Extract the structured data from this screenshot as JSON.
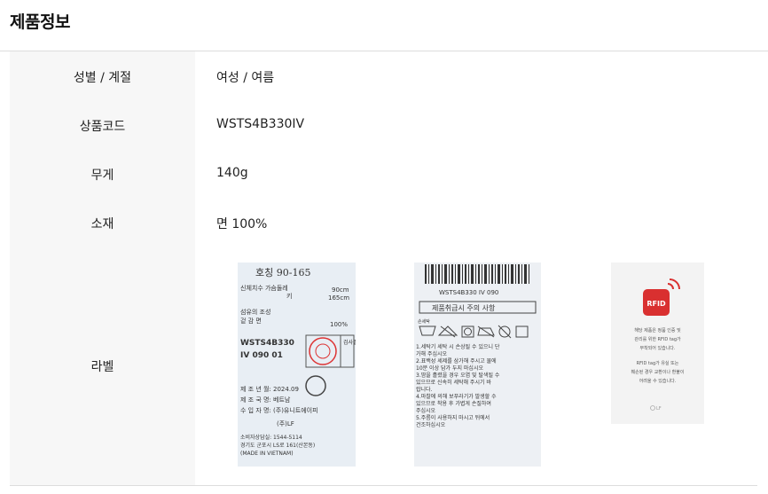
{
  "title": "제품정보",
  "rows": [
    {
      "label": "성별 / 계절",
      "value": "여성 / 여름"
    },
    {
      "label": "상품코드",
      "value": "WSTS4B330IV"
    },
    {
      "label": "무게",
      "value": "140g"
    },
    {
      "label": "소재",
      "value": "면 100%"
    },
    {
      "label": "라벨",
      "value": ""
    }
  ],
  "label1": {
    "lines": [
      "호칭  90-165",
      "신체치수 가슴둘레",
      "키",
      "90cm",
      "165cm",
      "섬유의 조성",
      "겉 감        면",
      "100%",
      "WSTS4B330",
      "IV 090 01",
      "검사필",
      "제 조 년 월: 2024.09",
      "제 조 국 명: 베트남",
      "수 입 자 명: (주)유니트에이피",
      "(주)LF",
      "소비자상담실: 1544-5114",
      "경기도 군포시 LS로 161(산본동)",
      "(MADE IN VIETNAM)"
    ]
  },
  "label2": {
    "lines": [
      "WSTS4B330 IV 090",
      "제품취급시 주의 사항",
      "손세탁",
      "1.세탁기 세탁 시 손상될 수 있으니 단",
      "  가해 주십시오",
      "2.표백성 세제를 삼가해 주시고 물에",
      "  10분 이상 담가 두지 마십시오",
      "3.땀을 흘렸을 경우 오염 및 탈색될 수",
      "  있으므로 신속히 세탁해 주시기 바",
      "  랍니다.",
      "4.마찰에 의해 보푸라기가 발생할 수",
      "  있으므로 착용 후 가볍게 손질하여",
      "  주십시오",
      "5.주름이 사용하지 마시고 뒤에서",
      "  건조하십시오"
    ]
  },
  "label3": {
    "rfid": "RFID",
    "lines": [
      "해당 제품은 정품 인증 및",
      "관리를 위한 RFID tag가",
      "부착되어 있습니다.",
      "RFID tag가 유실 또는",
      "훼손된 경우 교환이나 환불이",
      "어려울 수 있습니다."
    ],
    "brand": "LF"
  }
}
